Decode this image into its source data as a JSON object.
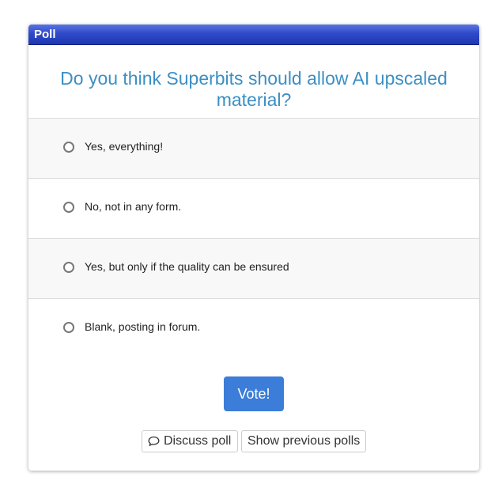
{
  "panel": {
    "title": "Poll"
  },
  "poll": {
    "question": "Do you think Superbits should allow AI upscaled material?",
    "options": [
      {
        "label": "Yes, everything!"
      },
      {
        "label": "No, not in any form."
      },
      {
        "label": "Yes, but only if the quality can be ensured"
      },
      {
        "label": "Blank, posting in forum."
      }
    ],
    "vote_label": "Vote!"
  },
  "footer": {
    "discuss_label": "Discuss poll",
    "discuss_icon": "comment-icon",
    "previous_label": "Show previous polls"
  },
  "colors": {
    "header_gradient_top": "#5b73e0",
    "header_gradient_bottom": "#1f37b0",
    "question_text": "#3b8fc4",
    "vote_button": "#3b7dd8"
  }
}
